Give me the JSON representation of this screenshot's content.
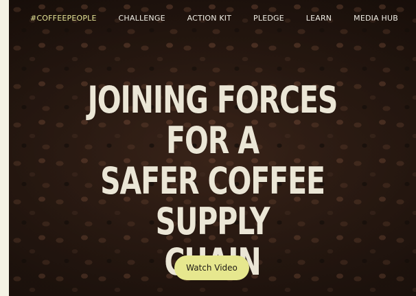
{
  "nav": {
    "items": [
      {
        "label": "#COFFEEPEOPLE"
      },
      {
        "label": "CHALLENGE"
      },
      {
        "label": "ACTION KIT"
      },
      {
        "label": "PLEDGE"
      },
      {
        "label": "LEARN"
      },
      {
        "label": "MEDIA HUB"
      }
    ]
  },
  "hero": {
    "headline_lines": [
      "JOINING FORCES FOR A",
      "SAFER COFFEE SUPPLY",
      "CHAIN"
    ],
    "cta_label": "Watch Video",
    "background": "coffee-beans-image"
  },
  "colors": {
    "page_background": "#f4f2e4",
    "nav_text": "#f1efe6",
    "brand_accent": "#e4e496",
    "headline_text": "#ebe6d6",
    "button_background": "#e6e78e",
    "button_text": "#1d1a14"
  }
}
